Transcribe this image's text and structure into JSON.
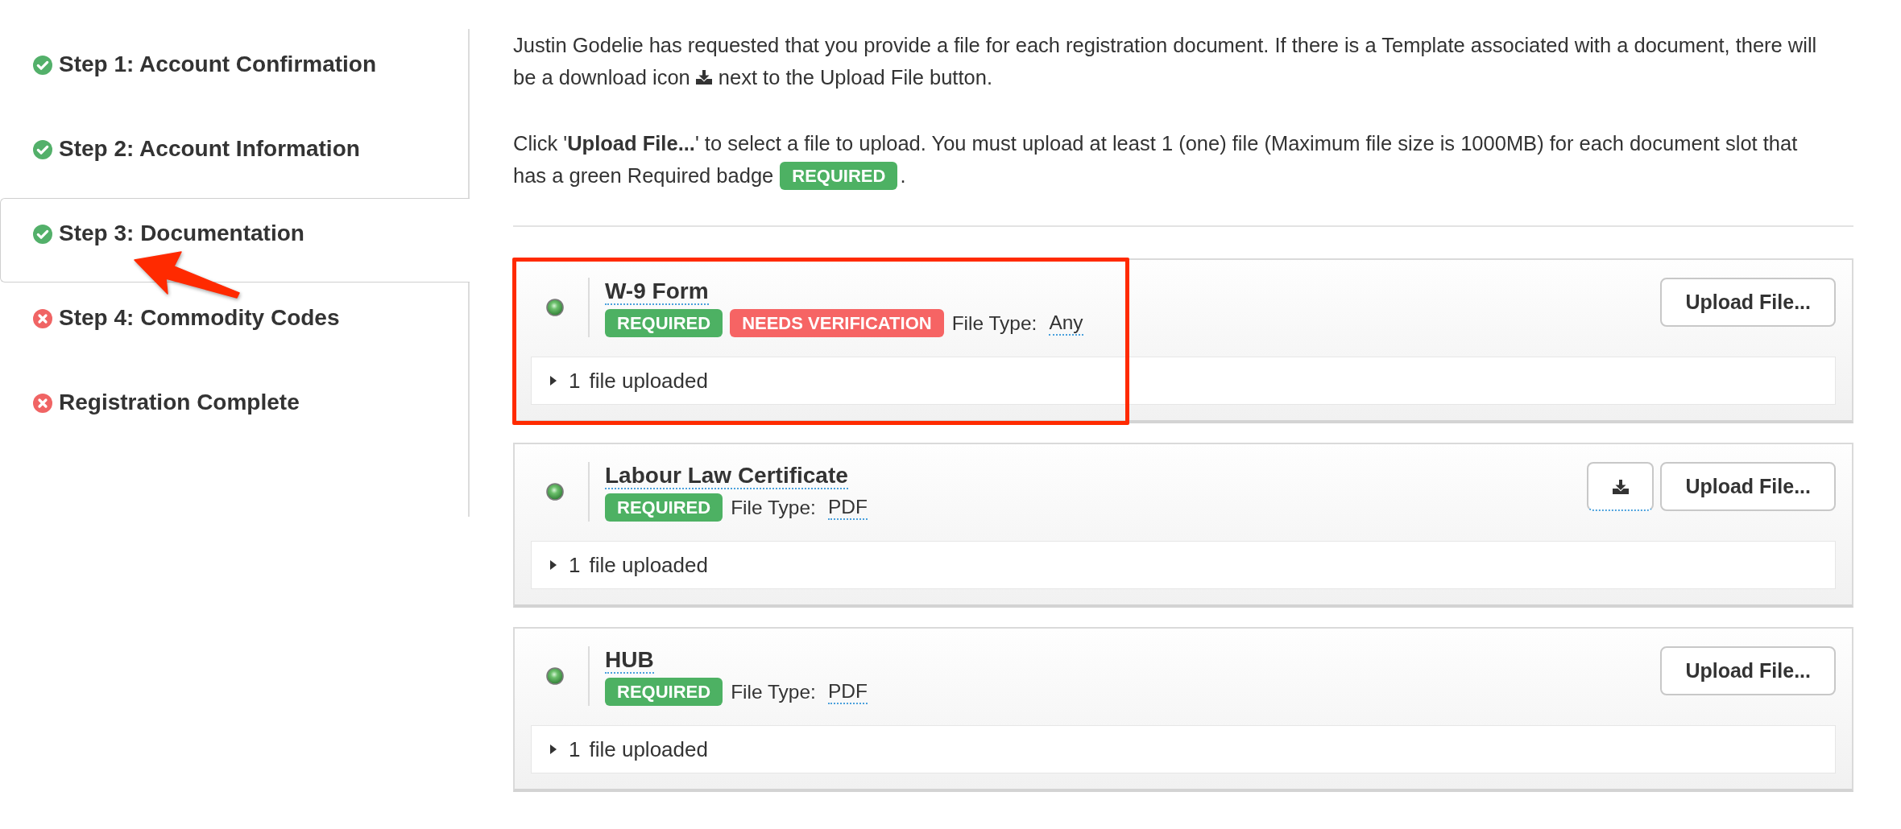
{
  "sidebar": {
    "steps": [
      {
        "label": "Step 1: Account Confirmation",
        "complete": true,
        "selected": false,
        "highlighted": false
      },
      {
        "label": "Step 2: Account Information",
        "complete": true,
        "selected": false,
        "highlighted": false
      },
      {
        "label": "Step 3: Documentation",
        "complete": true,
        "selected": true,
        "highlighted": true
      },
      {
        "label": "Step 4: Commodity Codes",
        "complete": false,
        "selected": false,
        "highlighted": false
      },
      {
        "label": "Registration Complete",
        "complete": false,
        "selected": false,
        "highlighted": false
      }
    ]
  },
  "intro": {
    "paragraph_1": {
      "line_1": "Justin Godelie has requested that you provide a file for each registration document. If there is a Template associated with a document, there will",
      "line_2_before_icon": "be a download icon",
      "line_2_after_icon": "next to the Upload File button."
    },
    "paragraph_2": {
      "line_1": "Click '**Upload File...**' to select a file to upload. You must upload at least 1 (one) file (Maximum file size is 1000MB) for each document slot that",
      "line_2_before_badge": "has a green Required badge",
      "badge": "REQUIRED",
      "line_2_after_badge": "."
    }
  },
  "documents": [
    {
      "title": "W-9 Form",
      "badges": [
        {
          "kind": "required",
          "label": "REQUIRED"
        },
        {
          "kind": "warning",
          "label": "NEEDS VERIFICATION"
        }
      ],
      "file_type_label": "File Type:",
      "file_type": "Any",
      "template_download": false,
      "upload_button": "Upload File...",
      "file_count": "1",
      "file_count_label": "file uploaded",
      "expanded": false,
      "highlighted": true
    },
    {
      "title": "Labour Law Certificate",
      "badges": [
        {
          "kind": "required",
          "label": "REQUIRED"
        }
      ],
      "file_type_label": "File Type:",
      "file_type": "PDF",
      "template_download": true,
      "upload_button": "Upload File...",
      "file_count": "1",
      "file_count_label": "file uploaded",
      "expanded": false,
      "highlighted": false
    },
    {
      "title": "HUB",
      "badges": [
        {
          "kind": "required",
          "label": "REQUIRED"
        }
      ],
      "file_type_label": "File Type:",
      "file_type": "PDF",
      "template_download": false,
      "upload_button": "Upload File...",
      "file_count": "1",
      "file_count_label": "file uploaded",
      "expanded": false,
      "highlighted": false
    }
  ]
}
